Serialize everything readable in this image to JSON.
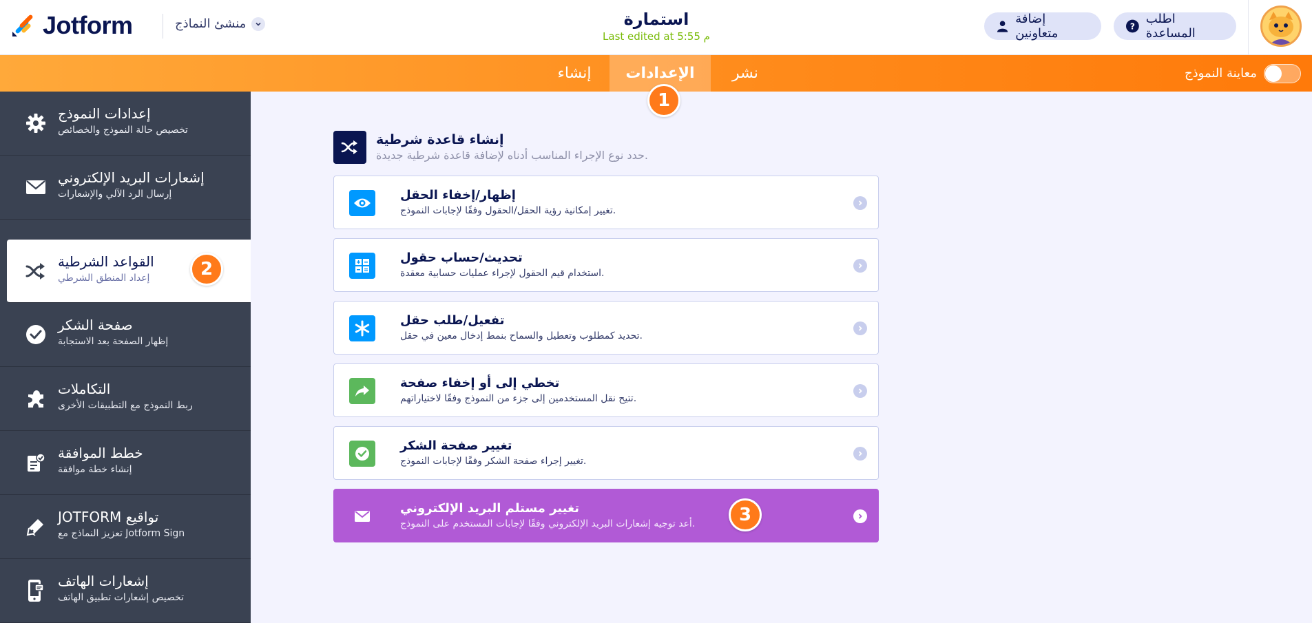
{
  "header": {
    "logo_text": "Jotform",
    "builder_label": "منشئ النماذج",
    "form_title": "استمارة",
    "last_edited": "Last edited at 5:55 م",
    "add_collaborators": "إضافة متعاونين",
    "get_help": "اطلب المساعدة"
  },
  "tabs": {
    "create": "إنشاء",
    "settings": "الإعدادات",
    "publish": "نشر",
    "preview_label": "معاينة النموذج"
  },
  "badges": {
    "one": "1",
    "two": "2",
    "three": "3"
  },
  "sidebar": {
    "items": [
      {
        "title": "إعدادات النموذج",
        "subtitle": "تخصيص حالة النموذج والخصائص",
        "icon": "gear-icon"
      },
      {
        "title": "إشعارات البريد الإلكتروني",
        "subtitle": "إرسال الرد الآلي والإشعارات",
        "icon": "envelope-icon"
      },
      {
        "title": "القواعد الشرطية",
        "subtitle": "إعداد المنطق الشرطي",
        "icon": "shuffle-icon"
      },
      {
        "title": "صفحة الشكر",
        "subtitle": "إظهار الصفحة بعد الاستجابة",
        "icon": "check-circle-icon"
      },
      {
        "title": "التكاملات",
        "subtitle": "ربط النموذج مع التطبيقات الأخرى",
        "icon": "puzzle-icon"
      },
      {
        "title": "خطط الموافقة",
        "subtitle": "إنشاء خطة موافقة",
        "icon": "approval-icon"
      },
      {
        "title": "JOTFORM تواقيع",
        "subtitle": "تعزيز النماذج مع Jotform Sign",
        "icon": "pen-icon"
      },
      {
        "title": "إشعارات الهاتف",
        "subtitle": "تخصيص إشعارات تطبيق الهاتف",
        "icon": "phone-icon"
      }
    ]
  },
  "main": {
    "heading": "إنشاء قاعدة شرطية",
    "subheading": "حدد نوع الإجراء المناسب أدناه لإضافة قاعدة شرطية جديدة.",
    "cards": [
      {
        "title": "إظهار/إخفاء الحقل",
        "subtitle": "تغيير إمكانية رؤية الحقل/الحقول وفقًا لإجابات النموذج.",
        "icon": "eye-icon",
        "color": "#0099ff"
      },
      {
        "title": "تحديث/حساب حقول",
        "subtitle": "استخدام قيم الحقول لإجراء عمليات حسابية معقدة.",
        "icon": "calculator-icon",
        "color": "#0099ff"
      },
      {
        "title": "تفعيل/طلب حقل",
        "subtitle": "تحديد كمطلوب وتعطيل والسماح بنمط إدخال معين في حقل.",
        "icon": "asterisk-icon",
        "color": "#0099ff"
      },
      {
        "title": "تخطي إلى أو إخفاء صفحة",
        "subtitle": "تتيح نقل المستخدمين إلى جزء من النموذج وفقًا لاختياراتهم.",
        "icon": "share-arrow-icon",
        "color": "#5cb85c"
      },
      {
        "title": "تغيير صفحة الشكر",
        "subtitle": "تغيير إجراء صفحة الشكر وفقًا لإجابات النموذج.",
        "icon": "check-icon",
        "color": "#5cb85c"
      },
      {
        "title": "تغيير مستلم البريد الإلكتروني",
        "subtitle": "أعد توجيه إشعارات البريد الإلكتروني وفقًا لإجابات المستخدم على النموذج.",
        "icon": "envelope-icon",
        "color": "#b15ad6"
      }
    ]
  },
  "colors": {
    "accent_orange": "#ff7a1a",
    "sidebar_bg": "#3a4252",
    "purple": "#b15ad6",
    "navy": "#0a1551"
  }
}
